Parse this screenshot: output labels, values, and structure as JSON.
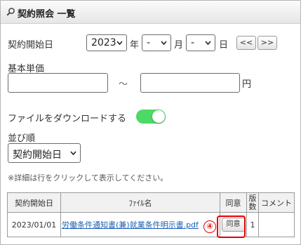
{
  "header": {
    "title": "契約照会 一覧",
    "icon": "search-icon"
  },
  "contract_start": {
    "label": "契約開始日",
    "year_value": "2023",
    "year_suffix": "年",
    "month_value": "-",
    "month_suffix": "月",
    "day_value": "-",
    "day_suffix": "日",
    "prev_label": "<<",
    "next_label": ">>"
  },
  "base_price": {
    "label": "基本単価",
    "min_value": "",
    "range_sep": "～",
    "max_value": "",
    "unit": "円"
  },
  "download": {
    "label": "ファイルをダウンロードする",
    "enabled": true
  },
  "sort": {
    "label": "並び順",
    "selected": "契約開始日"
  },
  "hint": "※詳細は行をクリックして表示してください。",
  "table": {
    "headers": [
      "契約開始日",
      "ﾌｧｲﾙ名",
      "同意",
      "版数",
      "コメント"
    ],
    "rows": [
      {
        "start_date": "2023/01/01",
        "file_name": "労働条件通知書(兼)就業条件明示書.pdf",
        "agree_label": "同意",
        "version": "1",
        "comment": ""
      }
    ]
  },
  "annotation": {
    "marker": "④",
    "color": "#e60000"
  },
  "colors": {
    "toggle_on": "#4cd964",
    "link": "#1a5fb4",
    "highlight": "#e60000"
  }
}
